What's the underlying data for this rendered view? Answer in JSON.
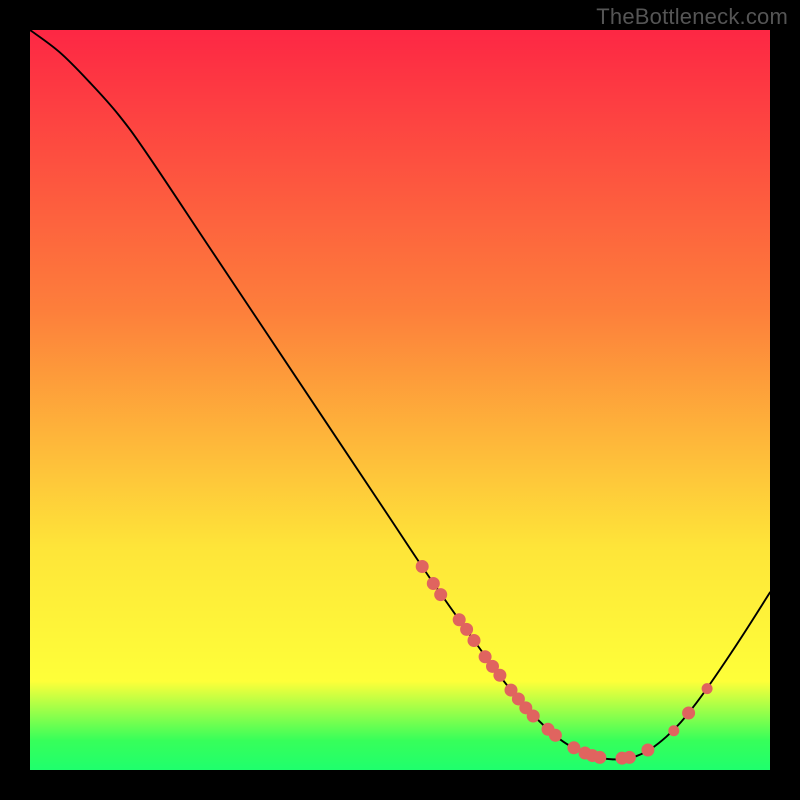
{
  "watermark": "TheBottleneck.com",
  "colors": {
    "frame_bg": "#000000",
    "curve": "#000000",
    "point": "#e0645f",
    "gradient_top": "#fd2744",
    "gradient_mid1": "#fd7f3b",
    "gradient_mid2": "#fee539",
    "gradient_mid3": "#feff39",
    "gradient_green": "#37ff5a",
    "gradient_bottom": "#1fff6d"
  },
  "chart_data": {
    "type": "line",
    "title": "",
    "xlabel": "",
    "ylabel": "",
    "xlim": [
      0,
      100
    ],
    "ylim": [
      0,
      100
    ],
    "curve": [
      {
        "x": 0.0,
        "y": 100.0
      },
      {
        "x": 4.0,
        "y": 97.0
      },
      {
        "x": 8.0,
        "y": 93.0
      },
      {
        "x": 12.0,
        "y": 88.5
      },
      {
        "x": 16.0,
        "y": 83.0
      },
      {
        "x": 24.0,
        "y": 71.0
      },
      {
        "x": 32.0,
        "y": 59.0
      },
      {
        "x": 40.0,
        "y": 47.0
      },
      {
        "x": 48.0,
        "y": 35.0
      },
      {
        "x": 54.0,
        "y": 26.0
      },
      {
        "x": 60.0,
        "y": 17.5
      },
      {
        "x": 65.0,
        "y": 10.8
      },
      {
        "x": 70.0,
        "y": 5.5
      },
      {
        "x": 74.0,
        "y": 2.7
      },
      {
        "x": 78.0,
        "y": 1.5
      },
      {
        "x": 82.0,
        "y": 1.9
      },
      {
        "x": 86.0,
        "y": 4.5
      },
      {
        "x": 90.0,
        "y": 9.0
      },
      {
        "x": 95.0,
        "y": 16.2
      },
      {
        "x": 100.0,
        "y": 24.0
      }
    ],
    "points": [
      {
        "x": 53.0,
        "y": 27.5,
        "r": 6
      },
      {
        "x": 54.5,
        "y": 25.2,
        "r": 6
      },
      {
        "x": 55.5,
        "y": 23.7,
        "r": 6
      },
      {
        "x": 58.0,
        "y": 20.3,
        "r": 6
      },
      {
        "x": 59.0,
        "y": 19.0,
        "r": 6
      },
      {
        "x": 60.0,
        "y": 17.5,
        "r": 6
      },
      {
        "x": 61.5,
        "y": 15.3,
        "r": 6
      },
      {
        "x": 62.5,
        "y": 14.0,
        "r": 6
      },
      {
        "x": 63.5,
        "y": 12.8,
        "r": 6
      },
      {
        "x": 65.0,
        "y": 10.8,
        "r": 6
      },
      {
        "x": 66.0,
        "y": 9.6,
        "r": 6
      },
      {
        "x": 67.0,
        "y": 8.4,
        "r": 6
      },
      {
        "x": 68.0,
        "y": 7.3,
        "r": 6
      },
      {
        "x": 70.0,
        "y": 5.5,
        "r": 6
      },
      {
        "x": 71.0,
        "y": 4.7,
        "r": 6
      },
      {
        "x": 73.5,
        "y": 3.0,
        "r": 6
      },
      {
        "x": 75.0,
        "y": 2.3,
        "r": 6
      },
      {
        "x": 76.0,
        "y": 1.95,
        "r": 6
      },
      {
        "x": 77.0,
        "y": 1.7,
        "r": 6
      },
      {
        "x": 80.0,
        "y": 1.6,
        "r": 6
      },
      {
        "x": 81.0,
        "y": 1.7,
        "r": 6
      },
      {
        "x": 83.5,
        "y": 2.7,
        "r": 6
      },
      {
        "x": 87.0,
        "y": 5.3,
        "r": 5
      },
      {
        "x": 89.0,
        "y": 7.7,
        "r": 6
      },
      {
        "x": 91.5,
        "y": 11.0,
        "r": 5
      }
    ]
  }
}
